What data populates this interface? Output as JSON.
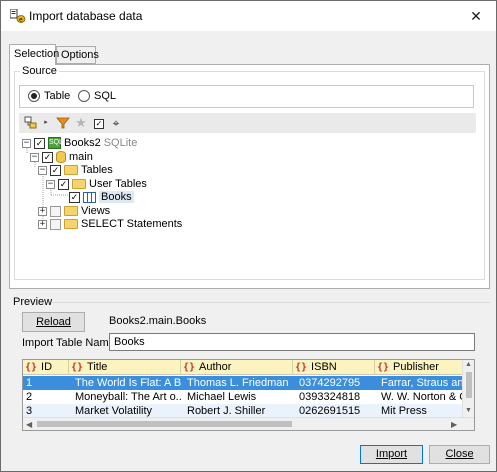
{
  "window": {
    "title": "Import database data",
    "close_glyph": "✕"
  },
  "tabs": [
    {
      "label": "Selection",
      "active": true
    },
    {
      "label": "Options",
      "active": false
    }
  ],
  "source": {
    "group_label": "Source",
    "radios": [
      {
        "label": "Table",
        "checked": true
      },
      {
        "label": "SQL",
        "checked": false
      }
    ]
  },
  "toolbar": {
    "icons": [
      "add-object-icon",
      "filter-icon",
      "favorite-icon",
      "check-icon",
      "locate-icon"
    ]
  },
  "tree": {
    "nodes": [
      {
        "label": "Books2",
        "suffix": "SQLite"
      },
      {
        "label": "main"
      },
      {
        "label": "Tables"
      },
      {
        "label": "User Tables"
      },
      {
        "label": "Books"
      },
      {
        "label": "Views"
      },
      {
        "label": "SELECT Statements"
      }
    ]
  },
  "preview": {
    "label": "Preview",
    "reload_label": "Reload",
    "path": "Books2.main.Books",
    "import_name_label": "Import Table Name:",
    "import_name_value": "Books"
  },
  "grid": {
    "columns": [
      "ID",
      "Title",
      "Author",
      "ISBN",
      "Publisher"
    ],
    "rows": [
      [
        "1",
        "The World Is Flat: A B...",
        "Thomas L. Friedman",
        "0374292795",
        "Farrar, Straus and"
      ],
      [
        "2",
        "Moneyball: The Art o...",
        "Michael Lewis",
        "0393324818",
        "W. W. Norton & C"
      ],
      [
        "3",
        "Market Volatility",
        "Robert J. Shiller",
        "0262691515",
        "Mit Press"
      ]
    ],
    "selected_row": 0
  },
  "footer": {
    "import_label": "Import",
    "close_label": "Close"
  },
  "colors": {
    "selection": "#3a8edc",
    "header_bg": "#fbf3c0",
    "column_icon": "#c0392b"
  }
}
